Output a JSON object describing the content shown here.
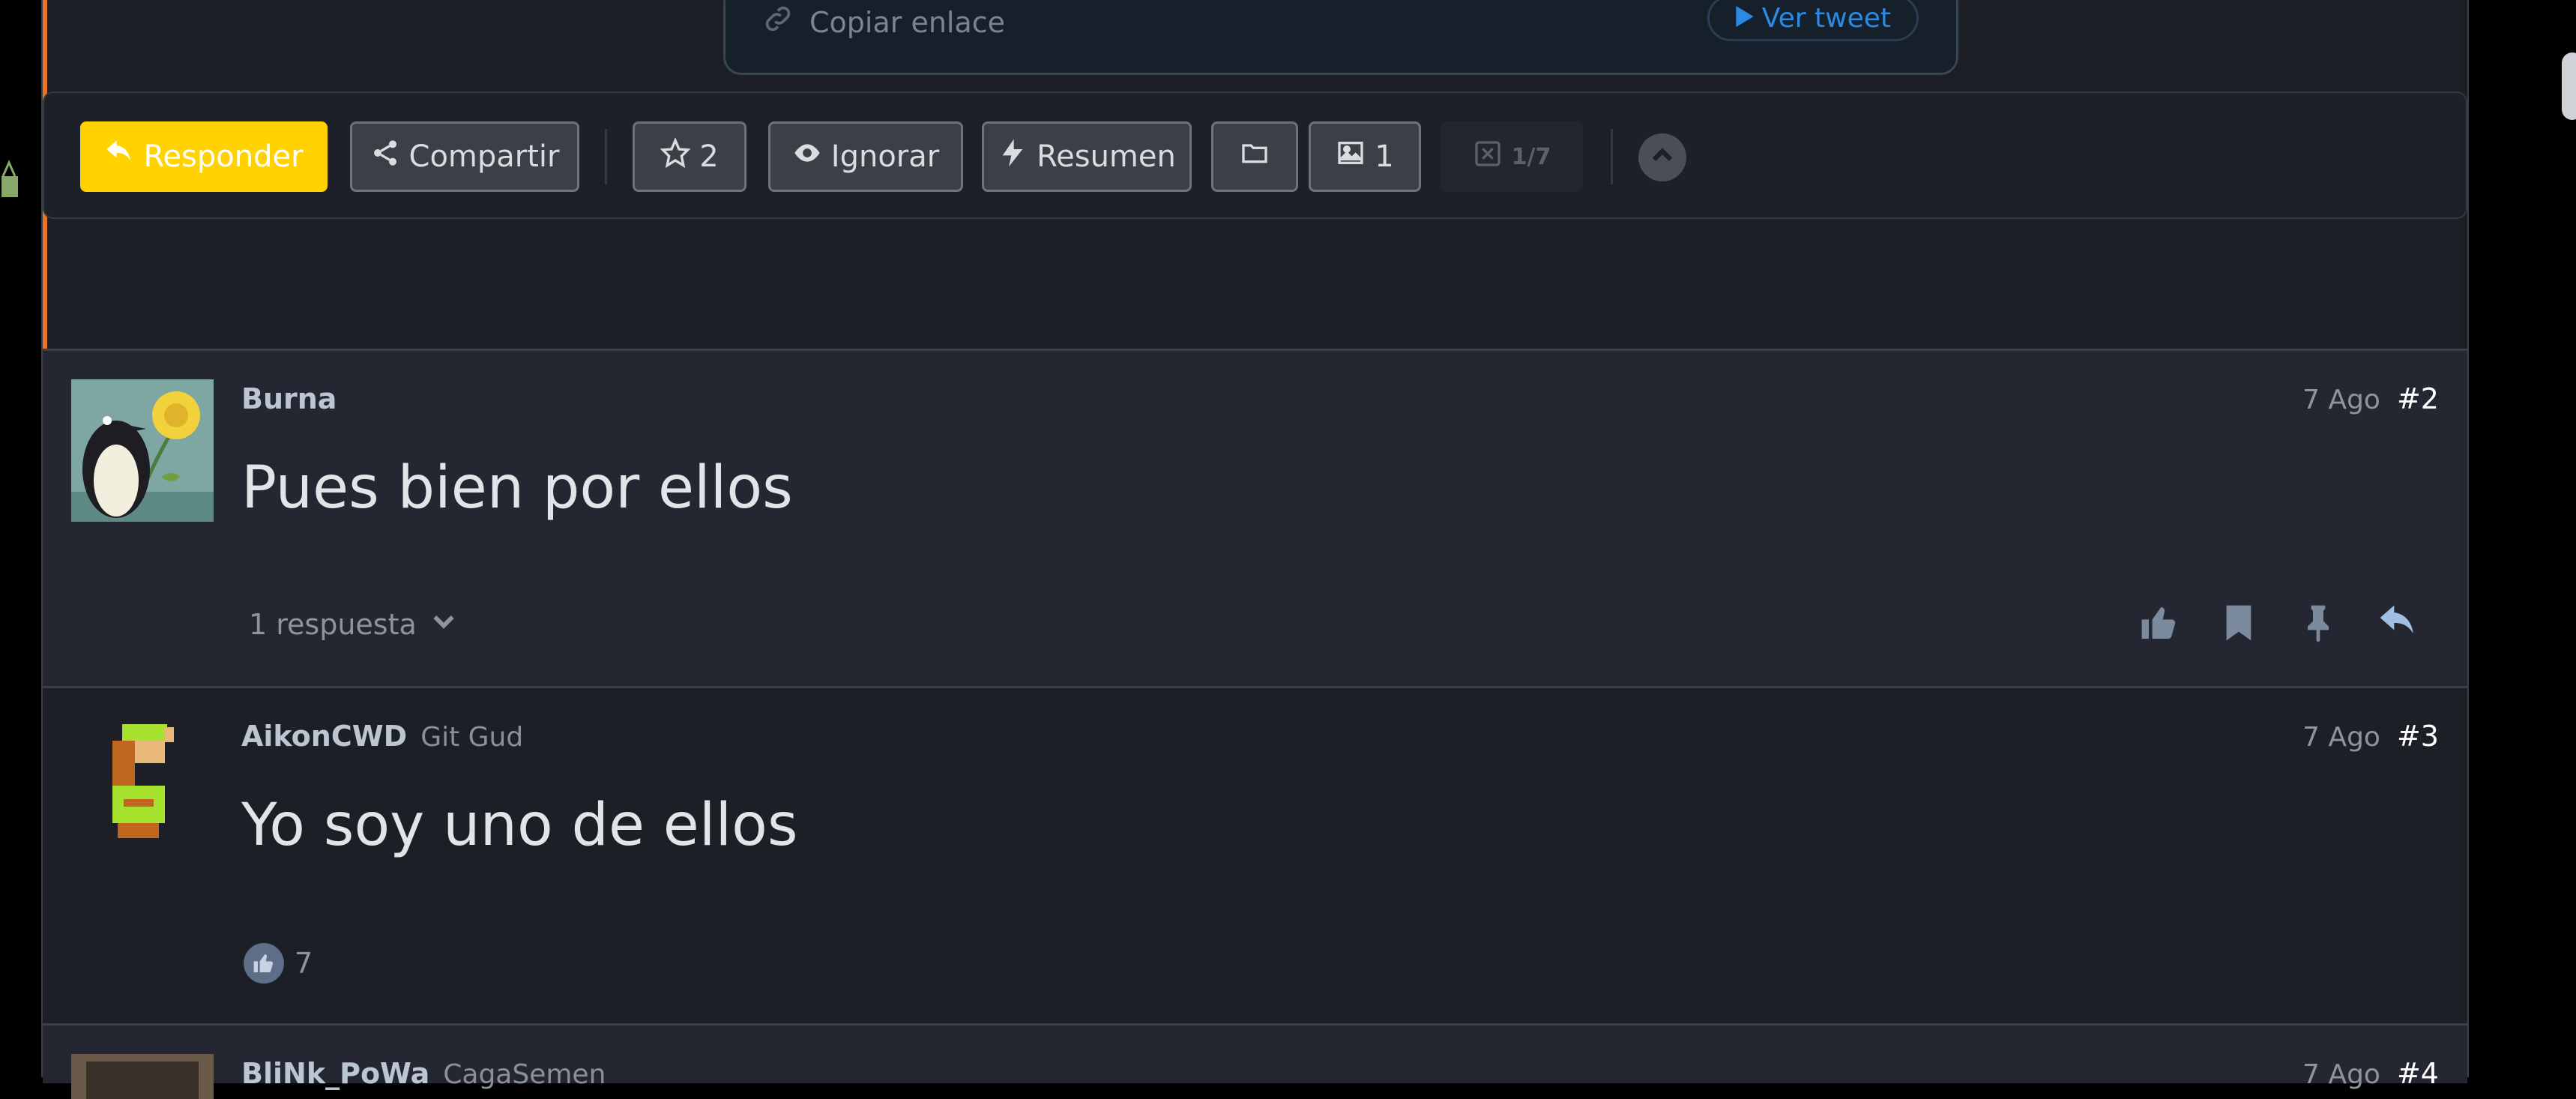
{
  "embed": {
    "copy_link": "Copiar enlace",
    "ver_tweet": "Ver tweet"
  },
  "toolbar": {
    "reply": "Responder",
    "share": "Compartir",
    "favorites_count": "2",
    "ignore": "Ignorar",
    "summary": "Resumen",
    "images_count": "1",
    "page_counter": "1/7"
  },
  "comments": [
    {
      "author": "Burna",
      "tagline": "",
      "date": "7 Ago",
      "number": "#2",
      "body": "Pues bien por ellos",
      "replies": "1 respuesta"
    },
    {
      "author": "AikonCWD",
      "tagline": "Git Gud",
      "date": "7 Ago",
      "number": "#3",
      "body": "Yo soy uno de ellos",
      "likes": "7"
    },
    {
      "author": "BliNk_PoWa",
      "tagline": "CagaSemen",
      "date": "7 Ago",
      "number": "#4"
    }
  ],
  "colors": {
    "accent": "#ffd200",
    "orange_bar": "#e8742a",
    "link_blue": "#2b8ae6"
  },
  "icons": [
    "link-icon",
    "play-icon",
    "reply-icon",
    "share-icon",
    "star-icon",
    "eye-icon",
    "bolt-icon",
    "folder-icon",
    "image-icon",
    "close-box-icon",
    "chevron-up-icon",
    "chevron-down-icon",
    "thumbs-up-icon",
    "bookmark-icon",
    "pin-icon"
  ]
}
